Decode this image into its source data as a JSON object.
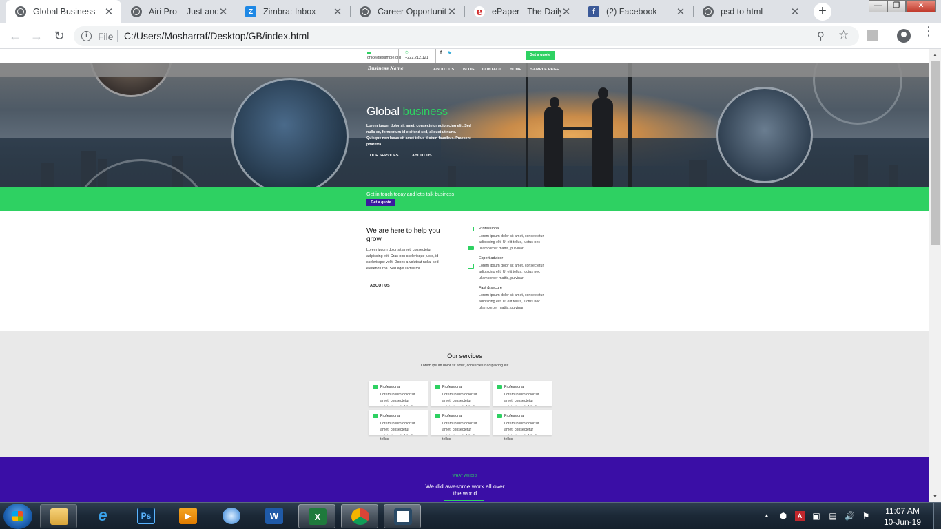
{
  "browser": {
    "tabs": [
      {
        "title": "Global Business",
        "active": true,
        "favicon": "globe-icon"
      },
      {
        "title": "Airi Pro – Just anoth",
        "active": false,
        "favicon": "globe-icon"
      },
      {
        "title": "Zimbra: Inbox",
        "active": false,
        "favicon": "zimbra-icon"
      },
      {
        "title": "Career Opportunity",
        "active": false,
        "favicon": "globe-icon"
      },
      {
        "title": "ePaper - The Daily",
        "active": false,
        "favicon": "epaper-icon"
      },
      {
        "title": "(2) Facebook",
        "active": false,
        "favicon": "facebook-icon"
      },
      {
        "title": "psd to html",
        "active": false,
        "favicon": "globe-icon"
      }
    ],
    "close_glyph": "✕",
    "new_tab_glyph": "+",
    "favicon_letters": {
      "zimbra": "Z",
      "epaper": "e",
      "facebook": "f"
    },
    "window_controls": {
      "minimize": "—",
      "maximize": "❐",
      "close": "✕"
    },
    "nav": {
      "back": "←",
      "forward": "→",
      "reload": "↻"
    },
    "omnibox": {
      "scheme_label": "File",
      "info_glyph": "i",
      "url": "C:/Users/Mosharraf/Desktop/GB/index.html",
      "zoom_glyph": "⚲",
      "star_glyph": "☆"
    },
    "menu_glyph": "⋮"
  },
  "page": {
    "topbar": {
      "email": "office@example.org",
      "phone": "+222.212.121",
      "facebook_glyph": "f",
      "twitter_glyph": "🐦",
      "quote_button": "Get a quote"
    },
    "nav": {
      "logo": "Business Name",
      "items": [
        "ABOUT US",
        "BLOG",
        "CONTACT",
        "HOME",
        "SAMPLE PAGE"
      ]
    },
    "hero": {
      "title_plain": "Global ",
      "title_accent": "business",
      "lead": "Lorem ipsum dolor sit amet, consectetur adipiscing elit. Sed nulla ex, fermentum id eleifend sed, aliquet ut nunc. Quisque non lacus sit amet tellus dictum faucibus. Praesent pharetra.",
      "buttons": [
        "OUR SERVICES",
        "ABOUT US"
      ]
    },
    "cta": {
      "text": "Get in touch today and let's talk business",
      "button": "Get a quote"
    },
    "about": {
      "heading": "We are here to help you grow",
      "paragraph": "Lorem ipsum dolor sit amet, consectetur adipiscing elit. Cras non scelerisque justo, id scelerisque velit. Donec a volutpat nulla, sed eleifend urna. Sed eget luctus mi.",
      "link": "ABOUT US",
      "features": [
        {
          "title": "Professional",
          "text": "Lorem ipsum dolor sit amet, consectetur adipiscing elit. Ut elit tellus, luctus nec ullamcorper mattis, pulvinar."
        },
        {
          "title": "Expert advisor",
          "text": "Lorem ipsum dolor sit amet, consectetur adipiscing elit. Ut elit tellus, luctus nec ullamcorper mattis, pulvinar."
        },
        {
          "title": "Fast & secure",
          "text": "Lorem ipsum dolor sit amet, consectetur adipiscing elit. Ut elit tellus, luctus nec ullamcorper mattis, pulvinar."
        }
      ]
    },
    "services": {
      "heading": "Our services",
      "subheading": "Lorem ipsum dolor sit amet, consectetur adipiscing elit",
      "cards": [
        {
          "title": "Professional",
          "text": "Lorem ipsum dolor sit amet, consectetur adipiscing elit. Ut elit"
        },
        {
          "title": "Professional",
          "text": "Lorem ipsum dolor sit amet, consectetur adipiscing elit. Ut elit"
        },
        {
          "title": "Professional",
          "text": "Lorem ipsum dolor sit amet, consectetur adipiscing elit. Ut elit"
        },
        {
          "title": "Professional",
          "text": "Lorem ipsum dolor sit amet, consectetur adipiscing elit. Ut elit tellus"
        },
        {
          "title": "Professional",
          "text": "Lorem ipsum dolor sit amet, consectetur adipiscing elit. Ut elit tellus"
        },
        {
          "title": "Professional",
          "text": "Lorem ipsum dolor sit amet, consectetur adipiscing elit. Ut elit tellus"
        }
      ],
      "overflow_word": "tellus"
    },
    "whatwe": {
      "kicker": "WHAT WE DID",
      "heading": "We did awesome work all over the world"
    }
  },
  "taskbar": {
    "apps": [
      {
        "name": "file-explorer",
        "icon": "folder-icon"
      },
      {
        "name": "internet-explorer",
        "icon": "ie-icon",
        "glyph": "e"
      },
      {
        "name": "photoshop",
        "icon": "photoshop-icon",
        "glyph": "Ps"
      },
      {
        "name": "media-player",
        "icon": "media-player-icon",
        "glyph": "▶"
      },
      {
        "name": "outlook",
        "icon": "outlook-icon"
      },
      {
        "name": "word",
        "icon": "word-icon",
        "glyph": "W"
      },
      {
        "name": "excel",
        "icon": "excel-icon",
        "glyph": "X"
      },
      {
        "name": "chrome",
        "icon": "chrome-icon"
      },
      {
        "name": "app",
        "icon": "frame-icon"
      }
    ],
    "tray_glyphs": [
      "▲",
      "⬢",
      "A",
      "▣",
      "▤",
      "🔊",
      "⚑"
    ],
    "time": "11:07 AM",
    "date": "10-Jun-19"
  },
  "colors": {
    "accent_green": "#2ed162",
    "brand_purple": "#3a0ea6",
    "cta_button": "#3a1a9e"
  }
}
